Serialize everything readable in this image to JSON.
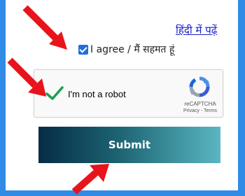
{
  "language_link": "हिंदी में पढ़ें",
  "agree": {
    "checked": true,
    "label": "I agree / मैं सहमत हूं"
  },
  "captcha": {
    "label": "I'm not a robot",
    "brand": "reCAPTCHA",
    "privacy": "Privacy",
    "separator": " - ",
    "terms": "Terms",
    "verified": true
  },
  "submit": {
    "label": "Submit"
  },
  "colors": {
    "background": "#2f8be6",
    "arrow": "#e8141b",
    "link": "#1a20c8",
    "check": "#1e9e54",
    "checkbox": "#1f6fe0",
    "submit_gradient_start": "#062c46",
    "submit_gradient_end": "#5ab6c2"
  },
  "icons": {
    "captcha_check": "green-checkmark-icon",
    "recaptcha_logo": "recaptcha-logo-icon",
    "annotation_arrows": "red-arrow-icon"
  }
}
